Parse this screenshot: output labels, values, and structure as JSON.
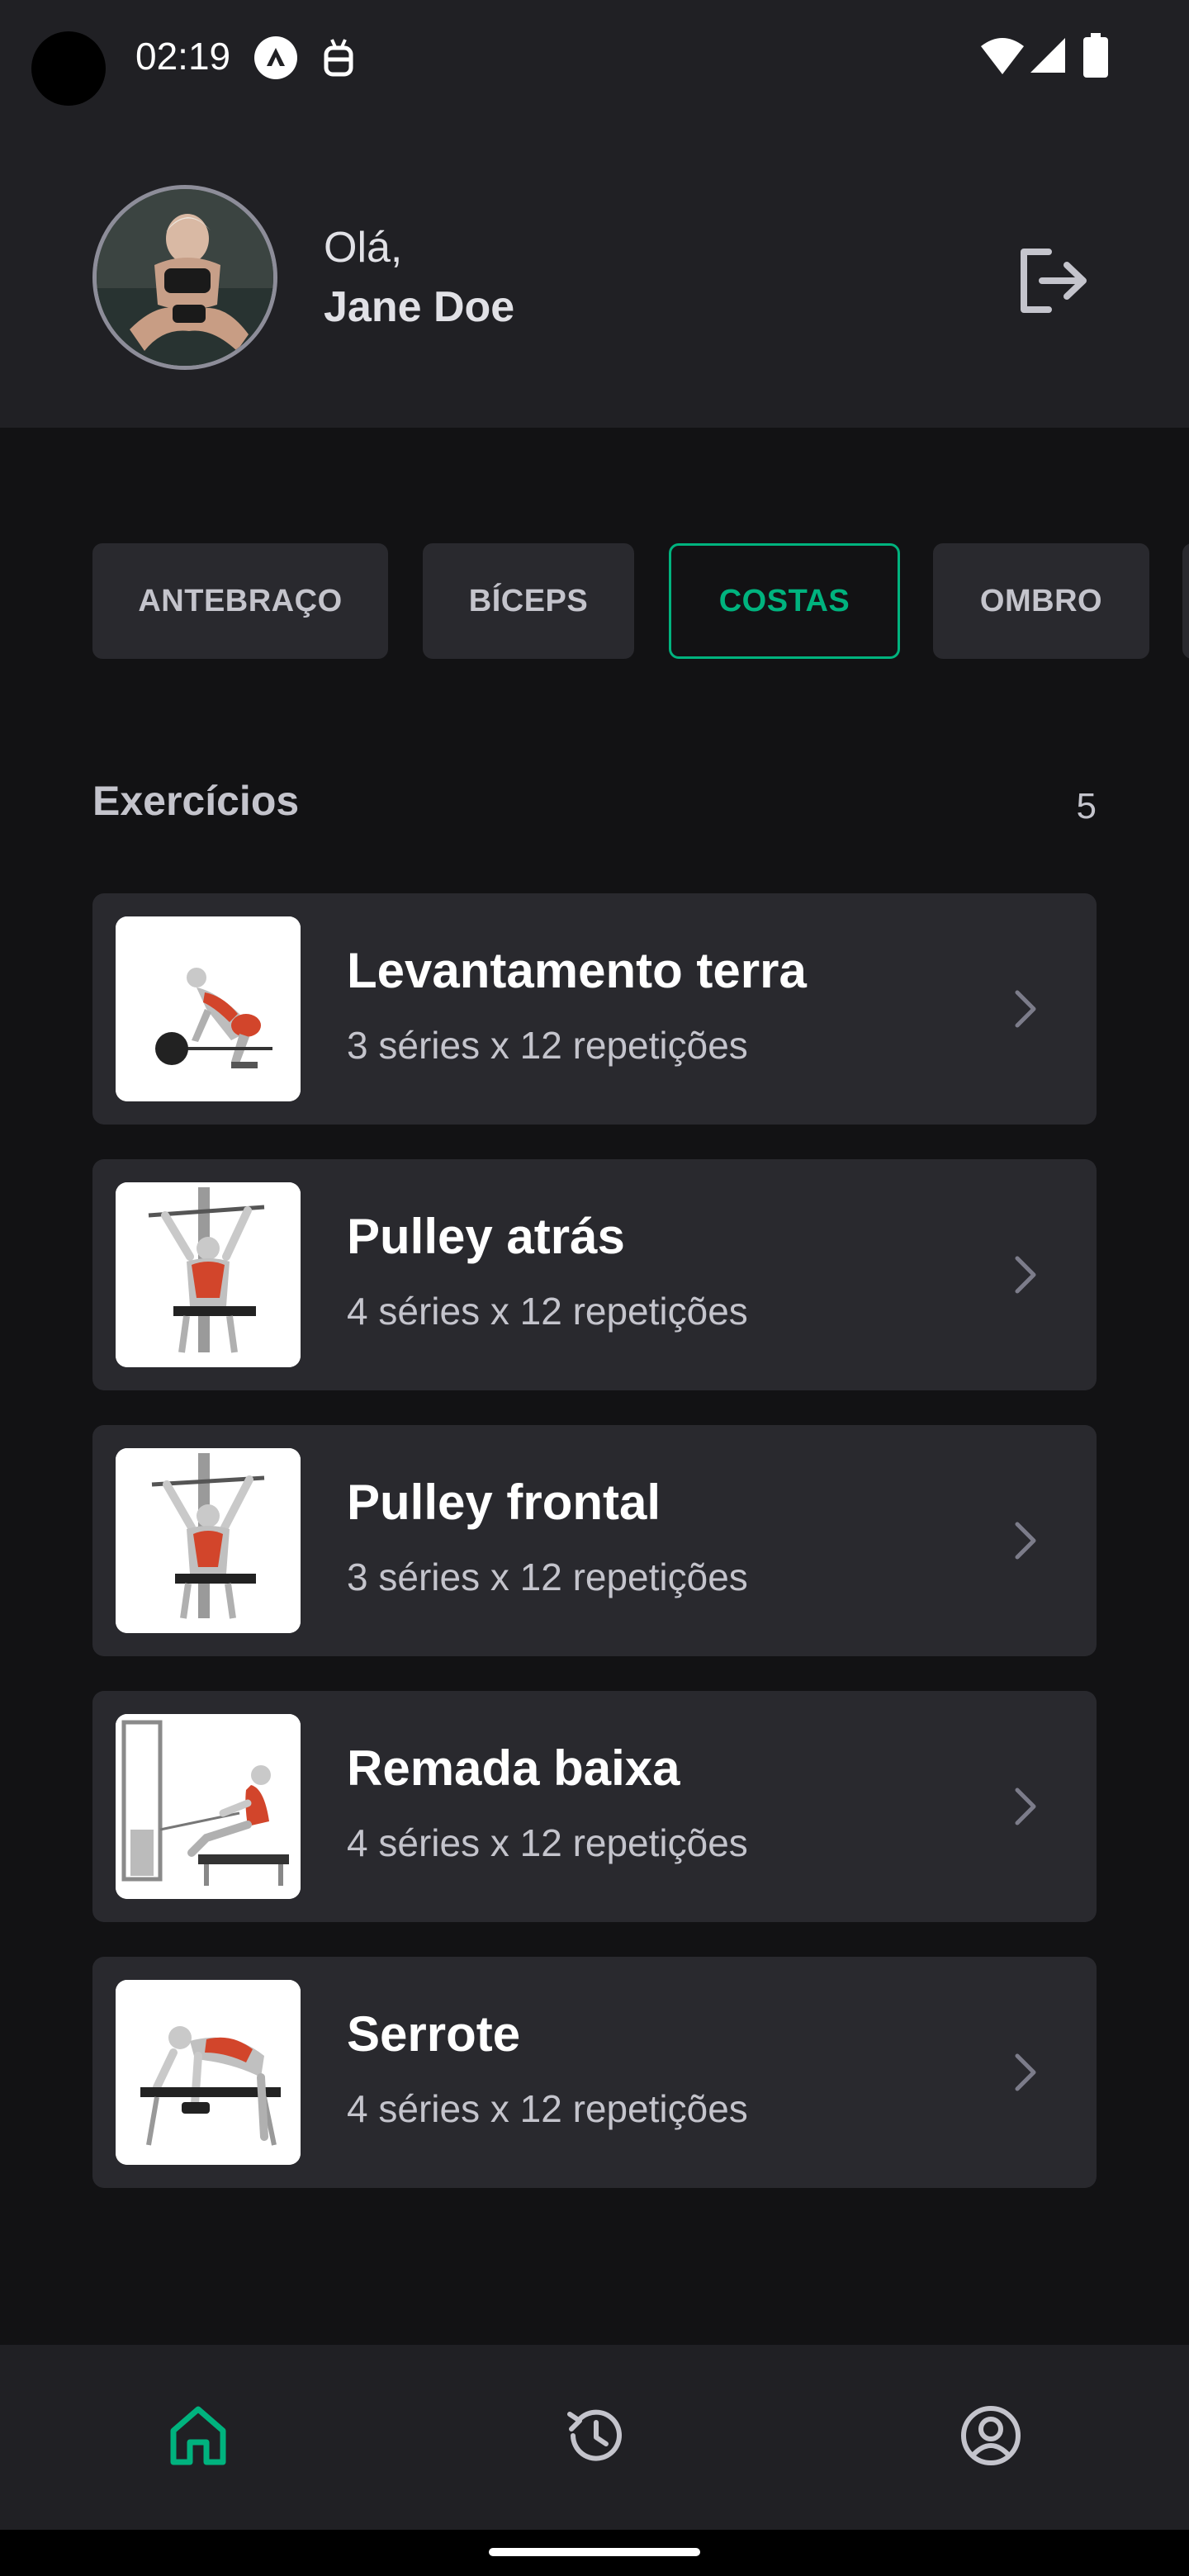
{
  "status_bar": {
    "time": "02:19"
  },
  "header": {
    "greeting": "Olá,",
    "user_name": "Jane Doe"
  },
  "groups": [
    {
      "label": "ANTEBRAÇO",
      "active": false
    },
    {
      "label": "BÍCEPS",
      "active": false
    },
    {
      "label": "COSTAS",
      "active": true
    },
    {
      "label": "OMBRO",
      "active": false
    }
  ],
  "exercises_section": {
    "title": "Exercícios",
    "count": "5"
  },
  "exercises": [
    {
      "name": "Levantamento terra",
      "meta": "3 séries x 12 repetições"
    },
    {
      "name": "Pulley atrás",
      "meta": "4 séries x 12 repetições"
    },
    {
      "name": "Pulley frontal",
      "meta": "3 séries x 12 repetições"
    },
    {
      "name": "Remada baixa",
      "meta": "4 séries x 12 repetições"
    },
    {
      "name": "Serrote",
      "meta": "4 séries x 12 repetições"
    }
  ],
  "bottom_nav": {
    "items": [
      {
        "icon": "home-icon",
        "active": true
      },
      {
        "icon": "history-icon",
        "active": false
      },
      {
        "icon": "profile-icon",
        "active": false
      }
    ]
  },
  "colors": {
    "accent": "#00b37e",
    "background": "#121214",
    "surface": "#202024",
    "card": "#29292e"
  }
}
